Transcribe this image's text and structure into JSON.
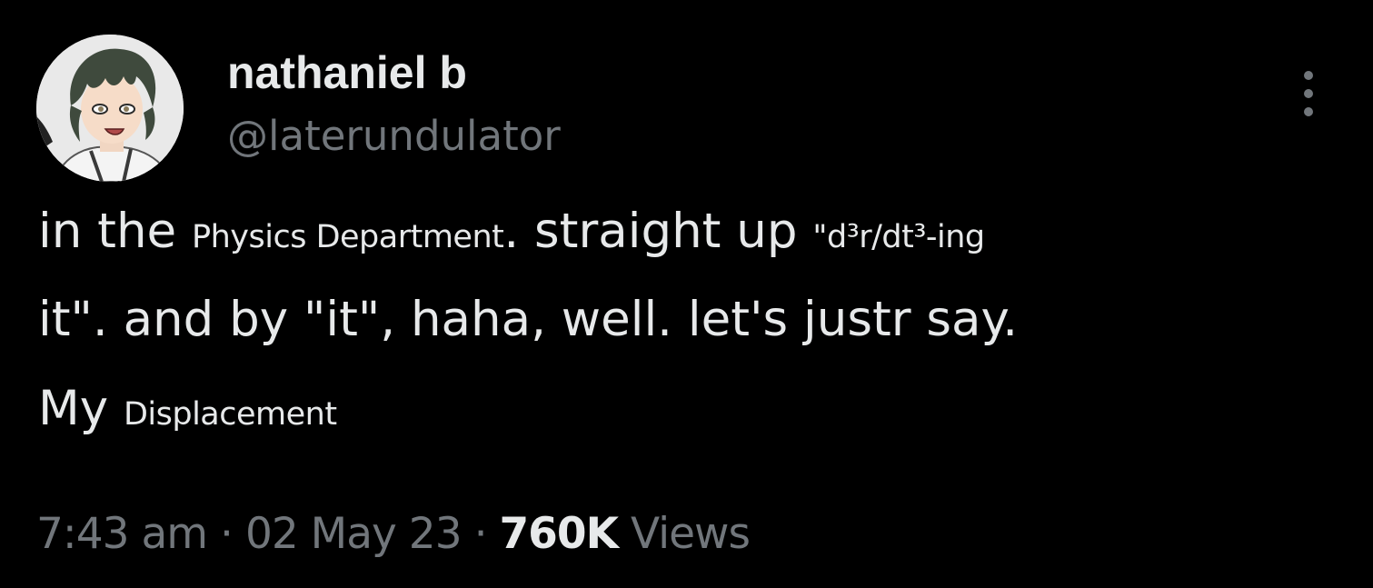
{
  "author": {
    "display_name": "nathaniel b",
    "handle": "@laterundulator",
    "avatar_icon": "anime-character-avatar"
  },
  "more_icon": "more-options-vertical-icon",
  "tweet": {
    "line1": {
      "a": "in the ",
      "small1": "Physics Department",
      "b": ". straight up ",
      "small2": "\"d³r/dt³-ing"
    },
    "line2": "it\". and by \"it\", haha, well. let's justr say.",
    "line3": {
      "a": "My ",
      "small": "Displacement"
    }
  },
  "meta": {
    "time": "7:43 am",
    "separator1": "·",
    "date": "02 May 23",
    "separator2": "·",
    "views_count": "760K",
    "views_label": "Views"
  },
  "colors": {
    "background": "#000000",
    "primary_text": "#e7e9ea",
    "secondary_text": "#71767b"
  }
}
